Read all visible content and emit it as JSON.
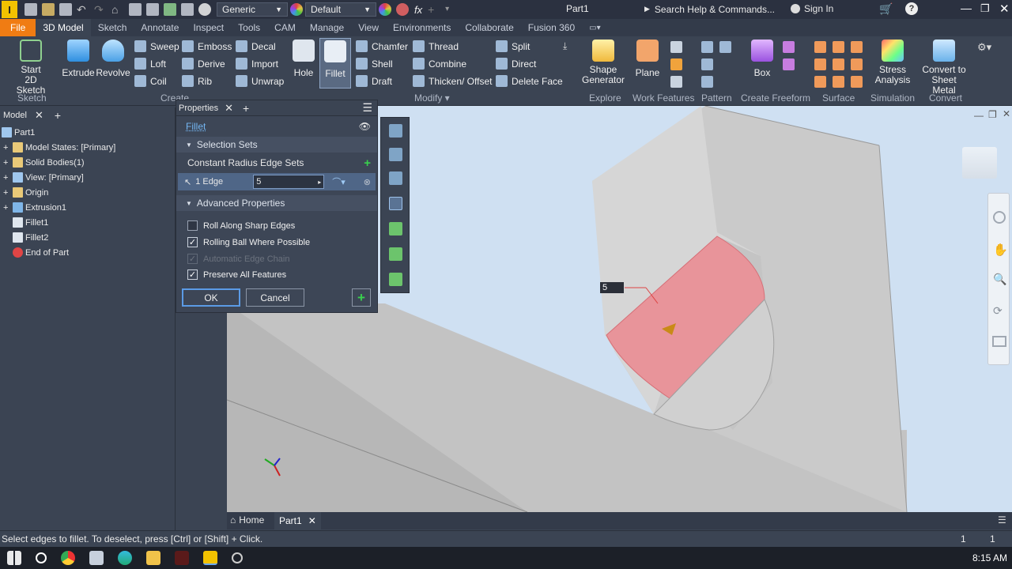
{
  "titlebar": {
    "appearance_dropdown": "Generic",
    "material_dropdown": "Default",
    "fx_label": "fx",
    "doc_title": "Part1",
    "search_placeholder": "Search Help & Commands...",
    "sign_in": "Sign In"
  },
  "tabs": [
    "File",
    "3D Model",
    "Sketch",
    "Annotate",
    "Inspect",
    "Tools",
    "CAM",
    "Manage",
    "View",
    "Environments",
    "Collaborate",
    "Fusion 360"
  ],
  "ribbon": {
    "start_sketch_line1": "Start",
    "start_sketch_line2": "2D Sketch",
    "extrude": "Extrude",
    "revolve": "Revolve",
    "sweep": "Sweep",
    "loft": "Loft",
    "coil": "Coil",
    "emboss": "Emboss",
    "derive": "Derive",
    "rib": "Rib",
    "decal": "Decal",
    "import": "Import",
    "unwrap": "Unwrap",
    "hole": "Hole",
    "fillet": "Fillet",
    "chamfer": "Chamfer",
    "shell": "Shell",
    "draft": "Draft",
    "thread": "Thread",
    "combine": "Combine",
    "thicken": "Thicken/ Offset",
    "split": "Split",
    "direct": "Direct",
    "delete_face": "Delete Face",
    "shape_gen_line1": "Shape",
    "shape_gen_line2": "Generator",
    "plane": "Plane",
    "box": "Box",
    "stress_line1": "Stress",
    "stress_line2": "Analysis",
    "convert_line1": "Convert to",
    "convert_line2": "Sheet Metal",
    "groups": {
      "sketch": "Sketch",
      "create": "Create",
      "modify": "Modify",
      "explore": "Explore",
      "work_features": "Work Features",
      "pattern": "Pattern",
      "create_freeform": "Create Freeform",
      "surface": "Surface",
      "simulation": "Simulation",
      "convert": "Convert"
    }
  },
  "browser": {
    "tab_label": "Model",
    "items": [
      "Part1",
      "Model States: [Primary]",
      "Solid Bodies(1)",
      "View: [Primary]",
      "Origin",
      "Extrusion1",
      "Fillet1",
      "Fillet2",
      "End of Part"
    ]
  },
  "properties": {
    "tab_label": "Properties",
    "feature_name": "Fillet",
    "selection_sets_header": "Selection Sets",
    "edge_sets_label": "Constant Radius Edge Sets",
    "edge_count": "1 Edge",
    "radius_value": "5",
    "advanced_header": "Advanced Properties",
    "options": [
      {
        "label": "Roll Along Sharp Edges",
        "checked": false,
        "disabled": false
      },
      {
        "label": "Rolling Ball Where Possible",
        "checked": true,
        "disabled": false
      },
      {
        "label": "Automatic Edge Chain",
        "checked": true,
        "disabled": true
      },
      {
        "label": "Preserve All Features",
        "checked": true,
        "disabled": false
      }
    ],
    "ok": "OK",
    "cancel": "Cancel"
  },
  "viewport": {
    "dimension_label": "5"
  },
  "doc_tabs": {
    "home": "Home",
    "part": "Part1"
  },
  "status": {
    "message": "Select edges to fillet. To deselect, press [Ctrl] or [Shift] + Click.",
    "count1": "1",
    "count2": "1"
  },
  "taskbar": {
    "time": "8:15 AM"
  },
  "colors": {
    "file_tab": "#f07c13",
    "ui_bg": "#3b4453",
    "fillet_face": "#e8949a",
    "viewport_bg": "#cfe0f2"
  }
}
